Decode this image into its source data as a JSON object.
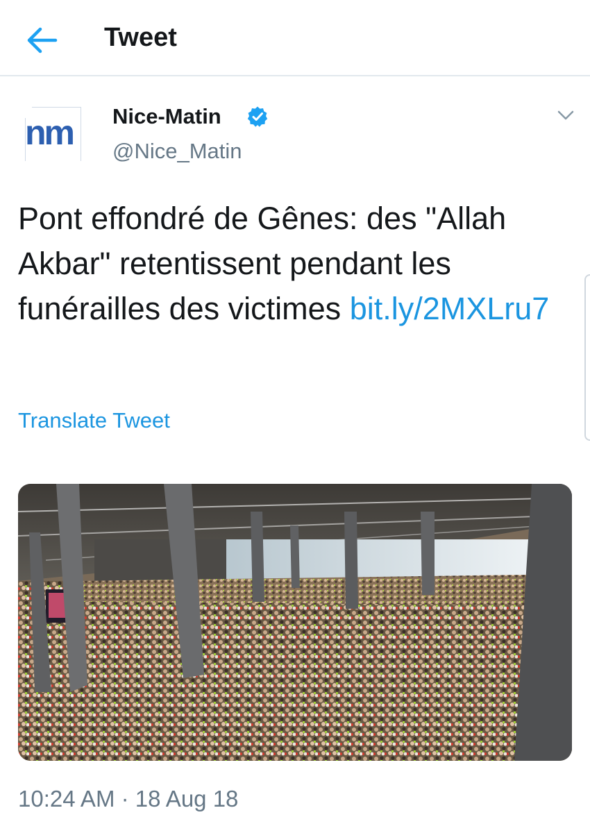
{
  "header": {
    "title": "Tweet",
    "back_icon": "arrow-left-icon"
  },
  "tweet": {
    "avatar_text": "nm",
    "display_name": "Nice-Matin",
    "verified": true,
    "handle": "@Nice_Matin",
    "text": "Pont effondré de Gênes: des \"Allah Akbar\" retentissent pendant les funérailles des victimes ",
    "link": "bit.ly/2MXLru7",
    "translate_label": "Translate Tweet",
    "timestamp": "10:24 AM · 18 Aug 18",
    "media_description": "crowd-in-hall-photo"
  },
  "colors": {
    "link": "#1b95e0",
    "secondary": "#657786",
    "text": "#14171a",
    "logo": "#2d5fb0"
  }
}
